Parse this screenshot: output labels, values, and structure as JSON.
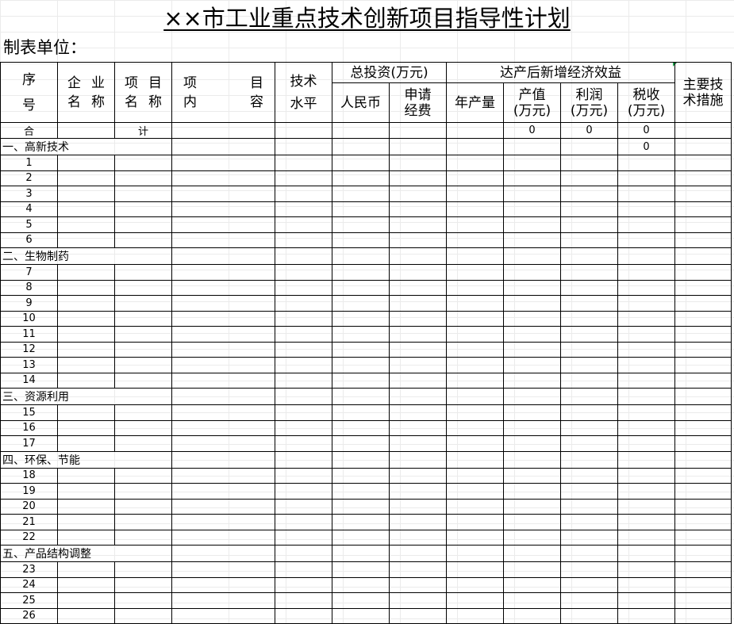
{
  "title": "××市工业重点技术创新项目指导性计划",
  "unit_label": "制表单位：",
  "header": {
    "seq_top": "序",
    "seq_bottom": "号",
    "company_a": "企",
    "company_b": "业",
    "company_c": "名",
    "company_d": "称",
    "project_a": "项",
    "project_b": "目",
    "project_c": "名",
    "project_d": "称",
    "content_a": "项",
    "content_b": "目",
    "content_c": "内",
    "content_d": "容",
    "tech_top": "技术",
    "tech_bottom": "水平",
    "investment": "总投资(万元)",
    "rmb": "人民币",
    "apply_top": "申请",
    "apply_bottom": "经费",
    "benefit": "达产后新增经济效益",
    "annual_output": "年产量",
    "output_value_top": "产值",
    "output_value_bottom": "(万元)",
    "profit_top": "利润",
    "profit_bottom": "(万元)",
    "tax_top": "税收",
    "tax_bottom": "(万元)",
    "measures_top": "主要技",
    "measures_bottom": "术措施"
  },
  "total_row": {
    "label_a": "合",
    "label_b": "计",
    "output_value": "0",
    "profit": "0",
    "tax": "0"
  },
  "sections": [
    {
      "title": "一、高新技术",
      "tax": "0",
      "rows": [
        "1",
        "2",
        "3",
        "4",
        "5",
        "6"
      ]
    },
    {
      "title": "二、生物制药",
      "tax": "",
      "rows": [
        "7",
        "8",
        "9",
        "10",
        "11",
        "12",
        "13",
        "14"
      ]
    },
    {
      "title": "三、资源利用",
      "tax": "",
      "rows": [
        "15",
        "16",
        "17"
      ]
    },
    {
      "title": "四、环保、节能",
      "tax": "",
      "rows": [
        "18",
        "19",
        "20",
        "21",
        "22"
      ]
    },
    {
      "title": "五、产品结构调整",
      "tax": "",
      "rows": [
        "23",
        "24",
        "25",
        "26"
      ]
    }
  ]
}
